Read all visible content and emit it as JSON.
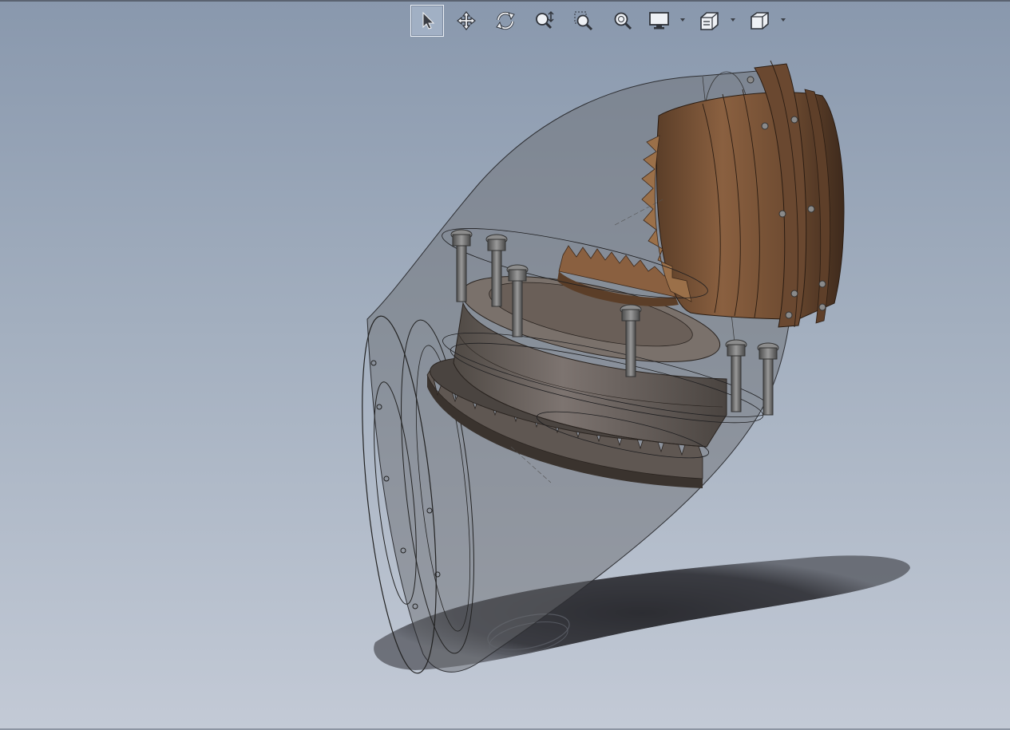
{
  "window": {
    "title": ""
  },
  "toolbar": {
    "buttons": [
      {
        "name": "select-tool-button",
        "icon": "pointer-icon",
        "active": true
      },
      {
        "name": "pan-button",
        "icon": "move-arrows-icon"
      },
      {
        "name": "rotate-button",
        "icon": "rotate-icon"
      },
      {
        "name": "zoom-in-out-button",
        "icon": "zoom-in-out-icon"
      },
      {
        "name": "zoom-to-area-button",
        "icon": "zoom-to-area-icon"
      },
      {
        "name": "zoom-to-fit-button",
        "icon": "zoom-to-fit-icon"
      },
      {
        "name": "display-style-button",
        "icon": "monitor-icon",
        "has_dropdown": true
      },
      {
        "name": "section-view-button",
        "icon": "section-view-icon",
        "has_dropdown": true
      },
      {
        "name": "view-orientation-button",
        "icon": "cube-icon",
        "has_dropdown": true
      }
    ]
  },
  "colors": {
    "background_top": "#8998ad",
    "background_bottom": "#c3cad6",
    "bronze": "#7a5436",
    "bronze_dark": "#3f2b1c",
    "steel": "#6f6862",
    "housing": "#6f6f74"
  },
  "model": {
    "description_icon": "bevel-gearbox-assembly"
  }
}
